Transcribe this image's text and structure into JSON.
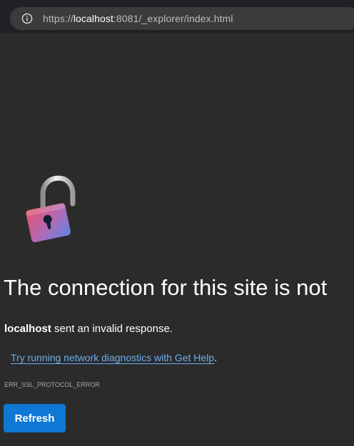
{
  "address_bar": {
    "url_prefix": "https://",
    "url_host": "localhost",
    "url_rest": ":8081/_explorer/index.html",
    "icon": "info-icon"
  },
  "error_page": {
    "icon": "unlocked-padlock-icon",
    "headline": "The connection for this site is not",
    "host": "localhost",
    "message_rest": " sent an invalid response.",
    "help_link": "Try running network diagnostics with Get Help",
    "help_suffix": ".",
    "error_code": "ERR_SSL_PROTOCOL_ERROR",
    "refresh_label": "Refresh"
  },
  "colors": {
    "background": "#2b2b2b",
    "link": "#6aaef0",
    "button": "#0f77d4"
  }
}
